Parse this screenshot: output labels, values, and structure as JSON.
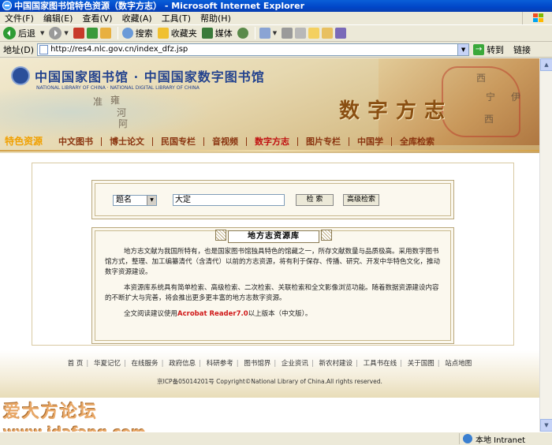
{
  "window": {
    "title": "中国国家图书馆特色资源（数字方志） - Microsoft Internet Explorer"
  },
  "menu": [
    "文件(F)",
    "编辑(E)",
    "查看(V)",
    "收藏(A)",
    "工具(T)",
    "帮助(H)"
  ],
  "toolbar": {
    "back": "后退",
    "search": "搜索",
    "favorites": "收藏夹",
    "media": "媒体"
  },
  "address": {
    "label": "地址(D)",
    "url": "http://res4.nlc.gov.cn/index_dfz.jsp",
    "go": "转到",
    "links": "链接"
  },
  "banner": {
    "logo_text": "中国国家图书馆 · 中国国家数字图书馆",
    "logo_en": "NATIONAL LIBRARY OF CHINA · NATIONAL DIGITAL LIBRARY OF CHINA",
    "title": "数字方志",
    "map_labels": [
      "雍",
      "河",
      "准",
      "阿",
      "西",
      "伊",
      "宁",
      "西"
    ]
  },
  "nav": {
    "home": "特色资源",
    "items": [
      "中文图书",
      "博士论文",
      "民国专栏",
      "音视频",
      "数字方志",
      "图片专栏",
      "中国学",
      "全库检索"
    ]
  },
  "search": {
    "field": "题名",
    "keyword": "大定",
    "btn_search": "检 索",
    "btn_advanced": "高级检索"
  },
  "intro": {
    "heading": "地方志资源库",
    "p1": "地方志文献为我国所特有，也是国家图书馆独具特色的馆藏之一，所存文献数量与品质极高。采用数字图书馆方式，整理、加工编纂清代（含清代）以前的方志资源，将有利于保存、传播、研究、开发中华特色文化，推动数字资源建设。",
    "p2": "本资源库系统具有简单检索、高级检索、二次检索、关联检索和全文影像浏览功能。随着数据资源建设内容的不断扩大与完善，将会推出更多更丰富的地方志数字资源。",
    "p3_prefix": "全文阅读建议使用",
    "p3_red": "Acrobat Reader7.0",
    "p3_suffix": "以上版本（中文版）。"
  },
  "footer": {
    "links": [
      "首 页",
      "华夏记忆",
      "在线服务",
      "政府信息",
      "科研参考",
      "图书馆界",
      "企业资讯",
      "新农村建设",
      "工具书在线",
      "关于国图",
      "站点地图"
    ],
    "copyright": "京ICP备05014201号 Copyright©National Library of China.All rights reserved."
  },
  "watermark": {
    "line1": "爱大方论坛",
    "line2": "www.idafang.com"
  },
  "status": {
    "zone": "本地 Intranet"
  }
}
